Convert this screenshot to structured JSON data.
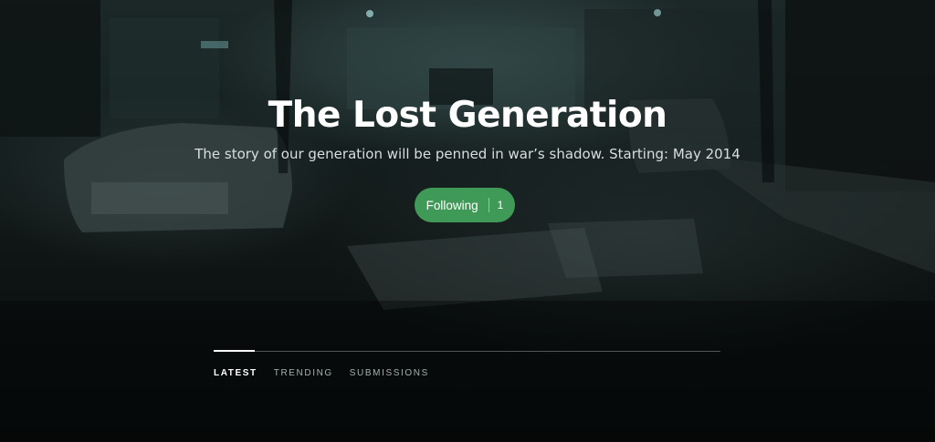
{
  "header": {
    "title": "The Lost Generation",
    "subtitle": "The story of our generation will be penned in war’s shadow. Starting: May 2014"
  },
  "follow": {
    "label": "Following",
    "count": "1",
    "color": "#3f9a57"
  },
  "tabs": [
    {
      "label": "LATEST",
      "active": true
    },
    {
      "label": "TRENDING",
      "active": false
    },
    {
      "label": "SUBMISSIONS",
      "active": false
    }
  ],
  "background": {
    "description_icon": "night-street-photo"
  }
}
